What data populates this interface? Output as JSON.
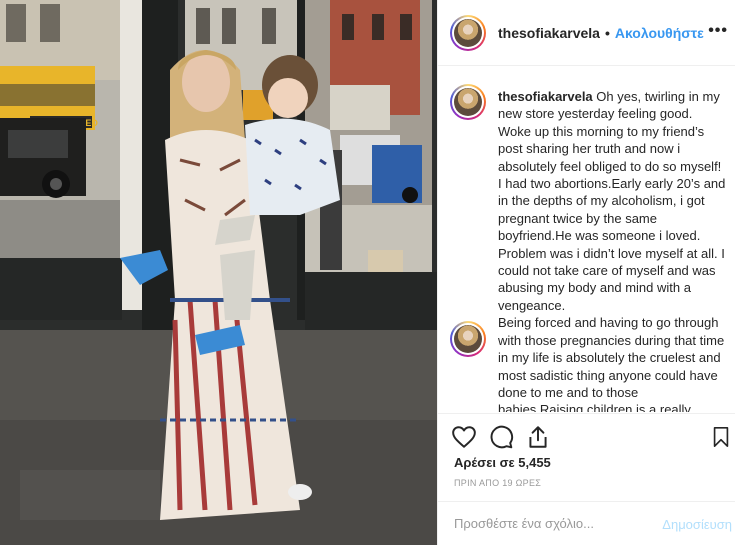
{
  "post": {
    "username": "thesofiakarvela",
    "follow_label": "Ακολουθήστε",
    "separator": "•",
    "more_label": "•••"
  },
  "caption": {
    "username": "thesofiakarvela",
    "text": " Oh yes, twirling in my new store yesterday feeling good. Woke up this morning to my friend’s post sharing her truth and now i absolutely feel obliged to do so myself! I had two abortions.Early early 20’s and in the depths of my alcoholism, i got pregnant twice by the same boyfriend.He was someone i loved. Problem was i didn’t love myself at all. I could not take care of myself and was abusing my body and mind with a vengeance.",
    "text2": "Being forced and having to go through with those pregnancies during that time in my life is absolutely the cruelest and most sadistic thing anyone could have done to me and to those babies.Raising children is a really important job..."
  },
  "icons": {
    "like": "heart-icon",
    "comment": "comment-bubble-icon",
    "share": "share-icon",
    "save": "bookmark-icon"
  },
  "stats": {
    "likes": "Αρέσει σε 5,455",
    "time": "ΠΡΙΝ ΑΠΟ 19 ΩΡΕΣ"
  },
  "comment": {
    "placeholder": "Προσθέστε ένα σχόλιο...",
    "post_label": "Δημοσίευση"
  },
  "photo_text": {
    "bus_sign": "ONSOLIDATED"
  },
  "colors": {
    "link": "#3897f0",
    "post_disabled": "#b2dffc",
    "muted": "#999999",
    "text": "#262626"
  }
}
